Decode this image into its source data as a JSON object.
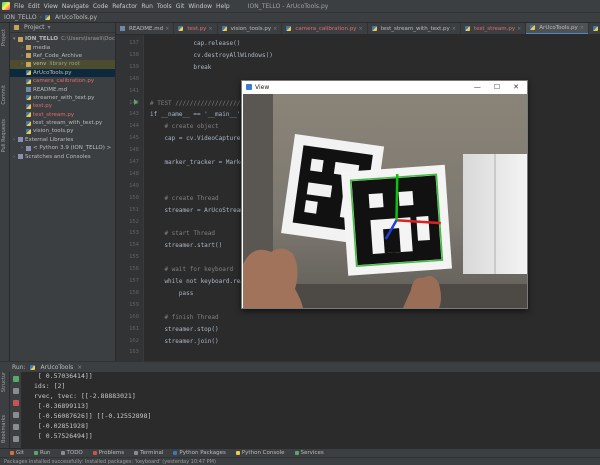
{
  "menubar": {
    "items": [
      "File",
      "Edit",
      "View",
      "Navigate",
      "Code",
      "Refactor",
      "Run",
      "Tools",
      "Git",
      "Window",
      "Help"
    ],
    "window_title": "ION_TELLO - ArUcoTools.py"
  },
  "breadcrumb": {
    "project": "ION_TELLO",
    "file": "ArUcoTools.py"
  },
  "sidebar_tabs": {
    "project": "Project",
    "commit": "Commit",
    "pull_requests": "Pull Requests",
    "structure": "Structure",
    "bookmarks": "Bookmarks"
  },
  "project_panel": {
    "header": "Project",
    "tree": [
      {
        "label": "ION_TELLO",
        "extra": "C:\\Users\\Israeli\\Docume",
        "type": "root",
        "depth": 0,
        "expanded": true
      },
      {
        "label": "media",
        "type": "folder",
        "depth": 1
      },
      {
        "label": "Ref_Code_Archive",
        "type": "folder",
        "depth": 1
      },
      {
        "label": "venv",
        "extra": "library root",
        "type": "folder",
        "depth": 1,
        "highlight": true
      },
      {
        "label": "ArUcoTools.py",
        "type": "py",
        "depth": 1,
        "selected": true
      },
      {
        "label": "camera_calibration.py",
        "type": "py",
        "depth": 1,
        "color": "red"
      },
      {
        "label": "README.md",
        "type": "md",
        "depth": 1
      },
      {
        "label": "streamer_with_text.py",
        "type": "py",
        "depth": 1
      },
      {
        "label": "test.py",
        "type": "py",
        "depth": 1,
        "color": "red"
      },
      {
        "label": "test_stream.py",
        "type": "py",
        "depth": 1,
        "color": "red"
      },
      {
        "label": "test_stream_with_text.py",
        "type": "py",
        "depth": 1
      },
      {
        "label": "vision_tools.py",
        "type": "py",
        "depth": 1
      },
      {
        "label": "External Libraries",
        "type": "lib",
        "depth": 0
      },
      {
        "label": "< Python 3.9 (ION_TELLO) >",
        "type": "lib",
        "depth": 1
      },
      {
        "label": "Scratches and Consoles",
        "type": "lib",
        "depth": 0
      }
    ]
  },
  "editor_tabs": [
    {
      "label": "README.md",
      "color": "normal"
    },
    {
      "label": "test.py",
      "color": "red"
    },
    {
      "label": "vision_tools.py",
      "color": "normal"
    },
    {
      "label": "camera_calibration.py",
      "color": "red"
    },
    {
      "label": "test_stream_with_text.py",
      "color": "normal"
    },
    {
      "label": "test_stream.py",
      "color": "red"
    },
    {
      "label": "ArUcoTools.py",
      "color": "normal",
      "active": true
    },
    {
      "label": "ArUcoToolsOld.py",
      "color": "red"
    }
  ],
  "editor": {
    "code_lines": [
      {
        "n": "137",
        "text": "            cap.release()"
      },
      {
        "n": "138",
        "text": "            cv.destroyAllWindows()"
      },
      {
        "n": "139",
        "text": "            break"
      },
      {
        "n": "140",
        "text": ""
      },
      {
        "n": "141",
        "text": ""
      },
      {
        "n": "142",
        "text": "# TEST ////////////////////"
      },
      {
        "n": "143",
        "text": "if __name__ == '__main__':"
      },
      {
        "n": "144",
        "text": "    # create object"
      },
      {
        "n": "145",
        "text": "    cap = cv.VideoCapture("
      },
      {
        "n": "146",
        "text": ""
      },
      {
        "n": "147",
        "text": "    marker_tracker = Marke"
      },
      {
        "n": "148",
        "text": ""
      },
      {
        "n": "149",
        "text": ""
      },
      {
        "n": "150",
        "text": "    # create Thread"
      },
      {
        "n": "151",
        "text": "    streamer = ArUcoStream"
      },
      {
        "n": "152",
        "text": ""
      },
      {
        "n": "153",
        "text": "    # start Thread"
      },
      {
        "n": "154",
        "text": "    streamer.start()"
      },
      {
        "n": "155",
        "text": ""
      },
      {
        "n": "156",
        "text": "    # wait for keyboard"
      },
      {
        "n": "157",
        "text": "    while not keyboard.rea"
      },
      {
        "n": "158",
        "text": "        pass"
      },
      {
        "n": "159",
        "text": ""
      },
      {
        "n": "160",
        "text": "    # finish Thread"
      },
      {
        "n": "161",
        "text": "    streamer.stop()"
      },
      {
        "n": "162",
        "text": "    streamer.join()"
      },
      {
        "n": "163",
        "text": ""
      }
    ]
  },
  "view_window": {
    "title": "View",
    "minimize": "—",
    "maximize": "☐",
    "close": "✕"
  },
  "run_panel": {
    "label": "Run:",
    "config": "ArUcoTools",
    "output_lines": [
      " [ 0.57036414]]",
      "ids: [2]",
      "rvec, tvec: [[-2.88883021]",
      " [-0.36899113]",
      " [-0.56087626]] [[-0.12552898]",
      " [-0.02851928]",
      " [ 0.57526494]]"
    ]
  },
  "bottom_tabs": [
    "Git",
    "Run",
    "TODO",
    "Problems",
    "Terminal",
    "Python Packages",
    "Python Console",
    "Services"
  ],
  "status": {
    "text": "Packages installed successfully: Installed packages: 'keyboard' (yesterday 10:47 PM)"
  },
  "colors": {
    "accent": "#4a88c7",
    "marker_green": "#3fbf3f",
    "axis_red": "#e02020",
    "axis_blue": "#2040e0"
  }
}
